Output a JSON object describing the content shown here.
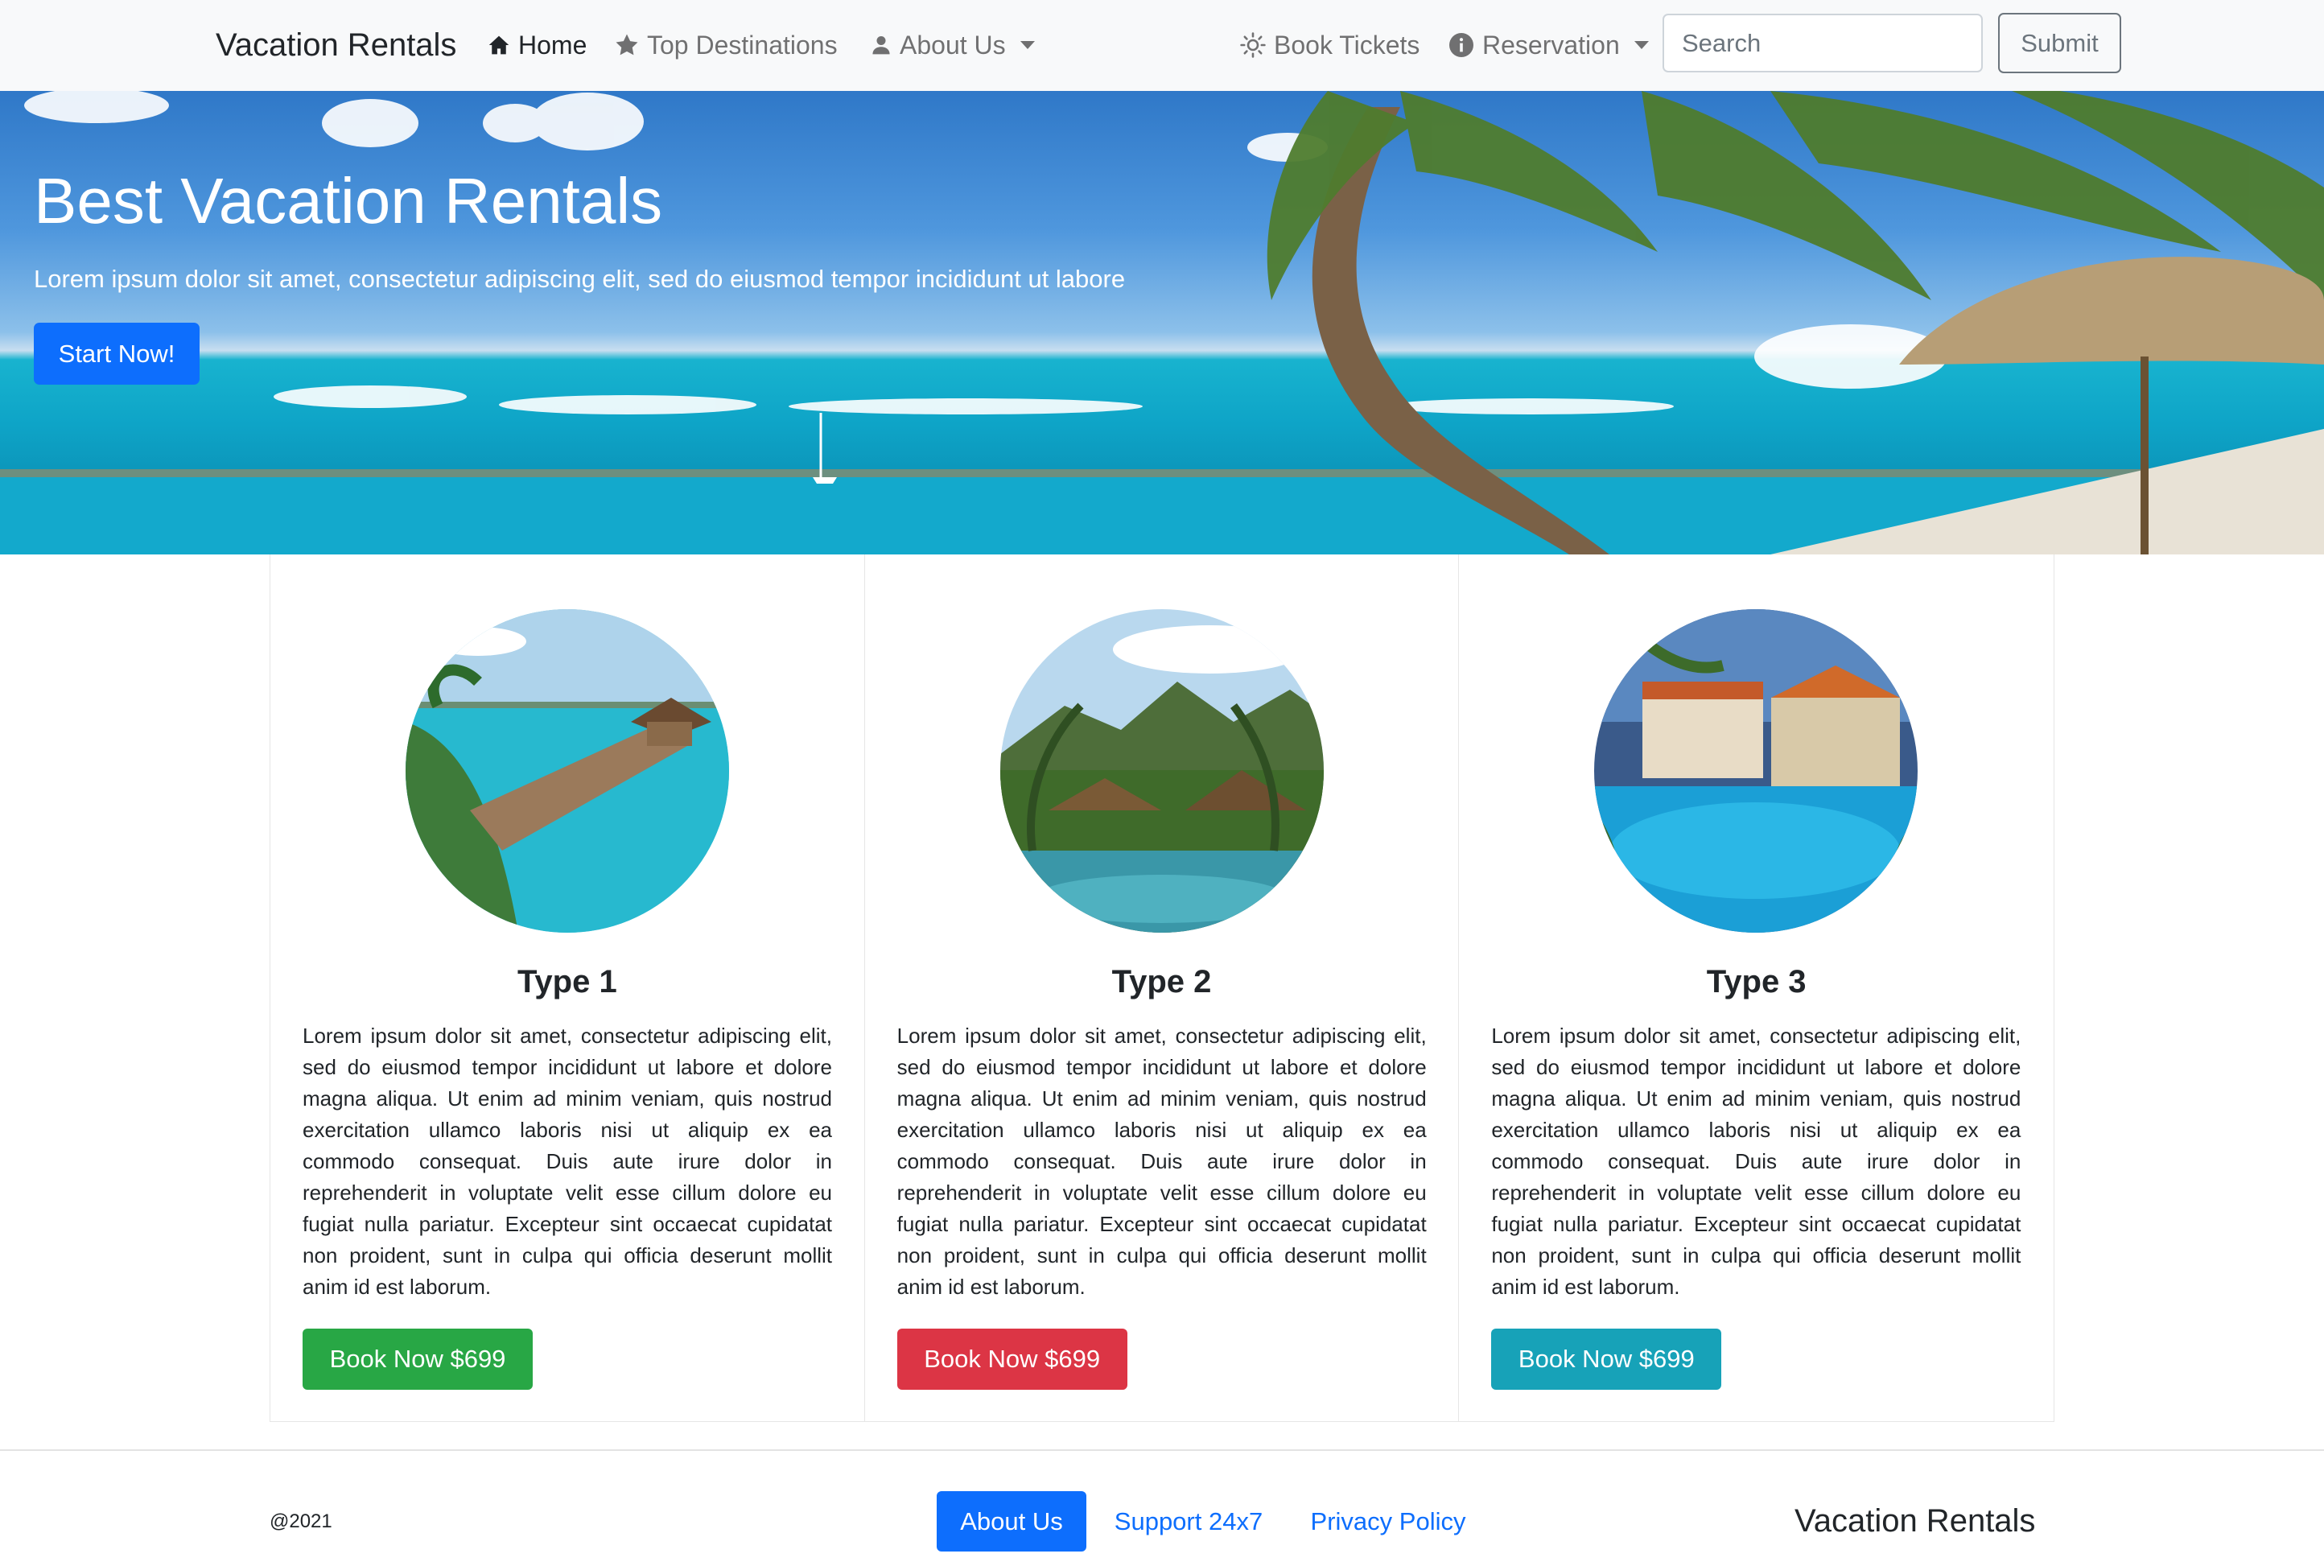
{
  "colors": {
    "navbar_bg": "#f8f9fa",
    "primary": "#0d6efd",
    "success": "#28a745",
    "danger": "#dc3545",
    "info": "#17a2b8"
  },
  "navbar": {
    "brand": "Vacation Rentals",
    "left_items": [
      {
        "label": "Home",
        "icon": "house-icon",
        "active": true
      },
      {
        "label": "Top Destinations",
        "icon": "star-icon"
      },
      {
        "label": "About Us",
        "icon": "person-icon",
        "dropdown": true
      }
    ],
    "right_items": [
      {
        "label": "Book Tickets",
        "icon": "sun-icon"
      },
      {
        "label": "Reservation",
        "icon": "info-circle-icon",
        "dropdown": true
      }
    ],
    "search": {
      "placeholder": "Search",
      "value": ""
    },
    "submit_label": "Submit"
  },
  "hero": {
    "title": "Best Vacation Rentals",
    "subtitle": "Lorem ipsum dolor sit amet, consectetur adipiscing elit, sed do eiusmod tempor incididunt ut labore",
    "button_label": "Start Now!"
  },
  "cards": [
    {
      "title": "Type 1",
      "text": "Lorem ipsum dolor sit amet, consectetur adipiscing elit, sed do eiusmod tempor incididunt ut labore et dolore magna aliqua. Ut enim ad minim veniam, quis nostrud exercitation ullamco laboris nisi ut aliquip ex ea commodo consequat. Duis aute irure dolor in reprehenderit in voluptate velit esse cillum dolore eu fugiat nulla pariatur. Excepteur sint occaecat cupidatat non proident, sunt in culpa qui officia deserunt mollit anim id est laborum.",
      "button_label": "Book Now $699",
      "button_color": "#28a745"
    },
    {
      "title": "Type 2",
      "text": "Lorem ipsum dolor sit amet, consectetur adipiscing elit, sed do eiusmod tempor incididunt ut labore et dolore magna aliqua. Ut enim ad minim veniam, quis nostrud exercitation ullamco laboris nisi ut aliquip ex ea commodo consequat. Duis aute irure dolor in reprehenderit in voluptate velit esse cillum dolore eu fugiat nulla pariatur. Excepteur sint occaecat cupidatat non proident, sunt in culpa qui officia deserunt mollit anim id est laborum.",
      "button_label": "Book Now $699",
      "button_color": "#dc3545"
    },
    {
      "title": "Type 3",
      "text": "Lorem ipsum dolor sit amet, consectetur adipiscing elit, sed do eiusmod tempor incididunt ut labore et dolore magna aliqua. Ut enim ad minim veniam, quis nostrud exercitation ullamco laboris nisi ut aliquip ex ea commodo consequat. Duis aute irure dolor in reprehenderit in voluptate velit esse cillum dolore eu fugiat nulla pariatur. Excepteur sint occaecat cupidatat non proident, sunt in culpa qui officia deserunt mollit anim id est laborum.",
      "button_label": "Book Now $699",
      "button_color": "#17a2b8"
    }
  ],
  "footer": {
    "copyright": "@2021",
    "links": [
      {
        "label": "About Us",
        "active": true
      },
      {
        "label": "Support 24x7"
      },
      {
        "label": "Privacy Policy"
      }
    ],
    "brand": "Vacation Rentals"
  }
}
